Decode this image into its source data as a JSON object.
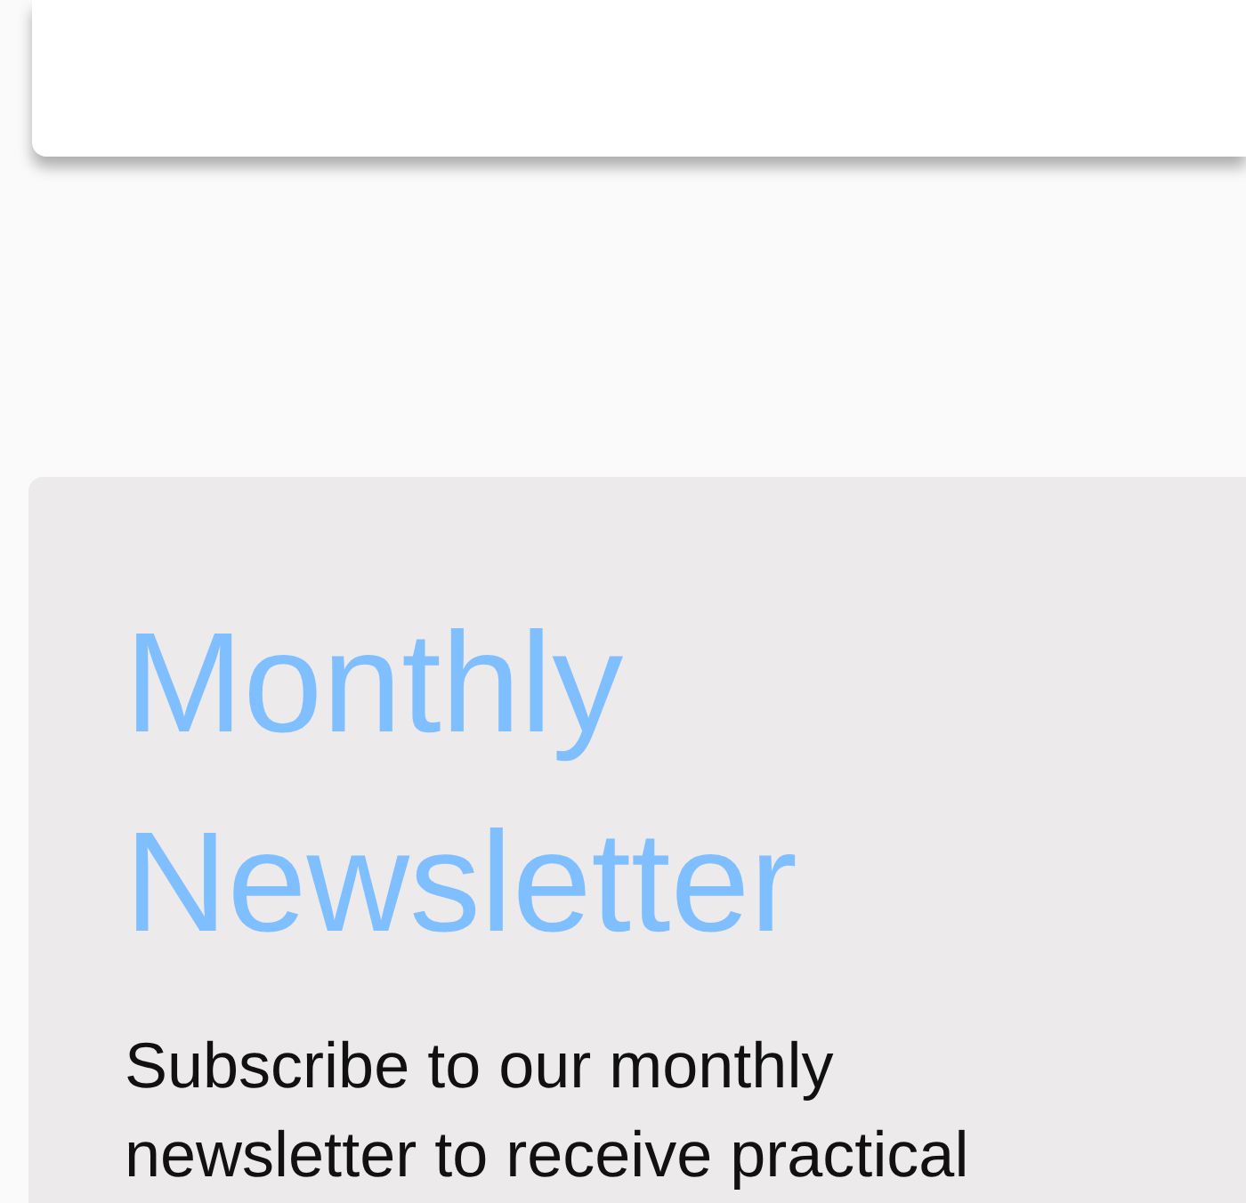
{
  "newsletter": {
    "title": "Monthly Newsletter",
    "description": "Subscribe to our monthly newsletter to receive practical"
  }
}
